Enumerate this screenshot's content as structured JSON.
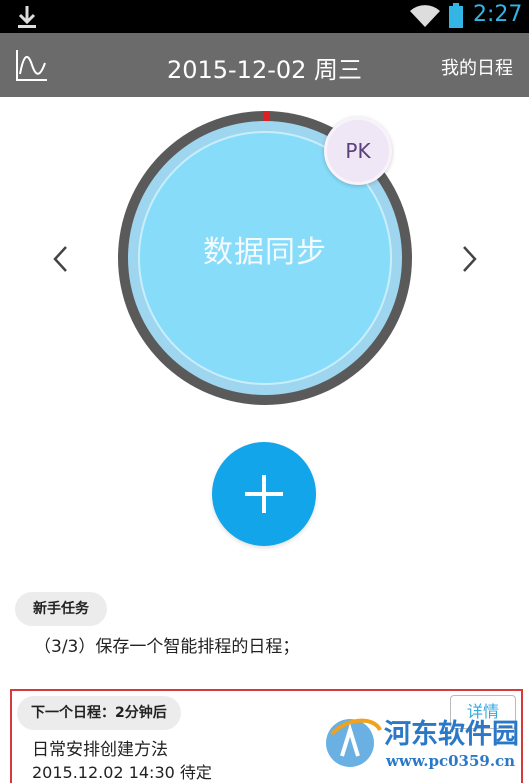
{
  "status_bar": {
    "time": "2:27",
    "icons": [
      "download-icon",
      "wifi-icon",
      "battery-icon"
    ],
    "time_color": "#33b5e5"
  },
  "app_bar": {
    "date": "2015-12-02 周三",
    "my_schedule": "我的日程",
    "chart_icon": "trend-chart-icon",
    "background": "#6b6b6b"
  },
  "sync_circle": {
    "label": "数据同步",
    "pk_label": "PK",
    "prev_icon": "chevron-left-icon",
    "next_icon": "chevron-right-icon",
    "fill_color": "#87dcfa",
    "ring_color": "#5a5a5a",
    "marker_color": "#e02020"
  },
  "add_button": {
    "icon": "plus-icon",
    "color": "#13a5ea"
  },
  "new_task": {
    "badge": "新手任务",
    "text": "（3/3）保存一个智能排程的日程；"
  },
  "next_schedule": {
    "badge": "下一个日程：2分钟后",
    "detail": "详情",
    "title": "日常安排创建方法",
    "time": "2015.12.02 14:30 待定",
    "highlight_color": "#d63a3a"
  },
  "watermark": {
    "name": "河东软件园",
    "url": "www.pc0359.cn"
  }
}
